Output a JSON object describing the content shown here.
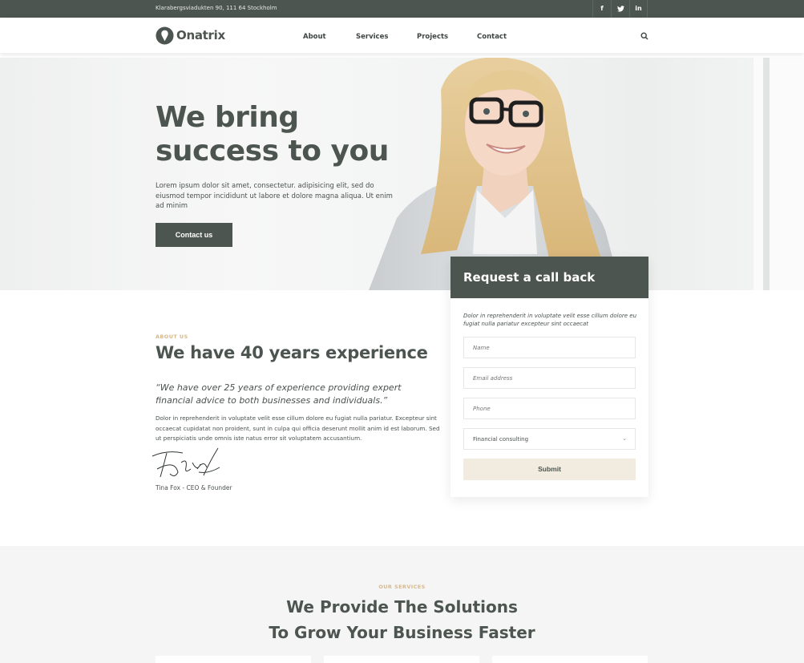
{
  "topbar": {
    "address": "Klarabergsviadukten 90, 111 64 Stockholm",
    "social": [
      {
        "icon": "facebook-icon",
        "glyph": "f"
      },
      {
        "icon": "twitter-icon",
        "glyph": "t"
      },
      {
        "icon": "linkedin-icon",
        "glyph": "in"
      }
    ]
  },
  "header": {
    "logo_text": "Onatrix",
    "nav": [
      "About",
      "Services",
      "Projects",
      "Contact"
    ],
    "search_icon": "search-icon"
  },
  "hero": {
    "title_line1": "We bring",
    "title_line2": "success to you",
    "text": "Lorem ipsum dolor sit amet, consectetur. adipisicing elit, sed do eiusmod tempor incididunt ut labore et dolore magna aliqua. Ut enim ad minim",
    "cta": "Contact us"
  },
  "callback": {
    "title": "Request a call back",
    "description": "Dolor in reprehenderit in voluptate velit esse cillum dolore eu fugiat nulla pariatur excepteur sint occaecat",
    "name_placeholder": "Name",
    "email_placeholder": "Email address",
    "phone_placeholder": "Phone",
    "select_value": "Financial consulting",
    "submit": "Submit"
  },
  "about": {
    "eyebrow": "ABOUT US",
    "title": "We have 40 years experience",
    "quote": "“We have over 25 years of experience providing expert financial advice to both businesses and individuals.”",
    "text": "Dolor in reprehenderit in voluptate velit esse cillum dolore eu fugiat nulla pariatur. Excepteur sint occaecat cupidatat non proident, sunt in culpa qui officia deserunt mollit anim id est laborum. Sed ut perspiciatis unde omnis iste natus error sit voluptatem accusantium.",
    "signature_caption": "Tina Fox - CEO & Founder"
  },
  "services": {
    "eyebrow": "OUR SERVICES",
    "title_line1": "We Provide The Solutions",
    "title_line2": "To Grow Your Business Faster"
  },
  "colors": {
    "primary": "#4d5550",
    "accent_gold": "#d7b98c",
    "submit_bg": "#f2ebdf",
    "section_bg": "#f5f5f5"
  }
}
